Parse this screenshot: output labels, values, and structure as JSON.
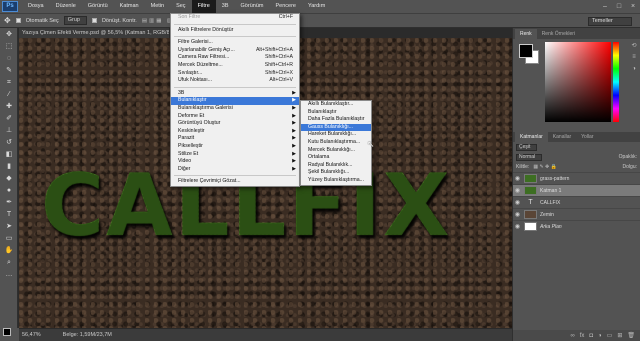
{
  "app": {
    "logo": "Ps"
  },
  "menubar": {
    "items": [
      "Dosya",
      "Düzenle",
      "Görüntü",
      "Katman",
      "Metin",
      "Seç",
      "Filtre",
      "3B",
      "Görünüm",
      "Pencere",
      "Yardım"
    ],
    "active_index": 6
  },
  "options_bar": {
    "auto_select_label": "Otomatik Seç",
    "auto_select_value": "Grup",
    "transform_label": "Dönüşt. Kontr.",
    "workspace": "Temeller"
  },
  "document": {
    "tab_title": "Yazıya Çimen Efekti Verme.psd @ 56,5% (Katman 1, RGB/8)",
    "canvas_text": "CALLFIX",
    "zoom": "56,47%",
    "doc_info": "Belge: 1,59M/23,7M"
  },
  "filter_menu": {
    "items": [
      {
        "label": "Son Filtre",
        "shortcut": "Ctrl+F",
        "disabled": true
      },
      {
        "sep": true
      },
      {
        "label": "Akıllı Filtrelere Dönüştür"
      },
      {
        "sep": true
      },
      {
        "label": "Filtre Galerisi..."
      },
      {
        "label": "Uyarlanabilir Geniş Açı...",
        "shortcut": "Alt+Shift+Ctrl+A"
      },
      {
        "label": "Camera Raw Filtresi...",
        "shortcut": "Shift+Ctrl+A"
      },
      {
        "label": "Mercek Düzeltme...",
        "shortcut": "Shift+Ctrl+R"
      },
      {
        "label": "Sıvılaştır...",
        "shortcut": "Shift+Ctrl+X"
      },
      {
        "label": "Ufuk Noktası...",
        "shortcut": "Alt+Ctrl+V"
      },
      {
        "sep": true
      },
      {
        "label": "3B",
        "submenu": true
      },
      {
        "label": "Bulanıklaştır",
        "submenu": true,
        "highlighted": true
      },
      {
        "label": "Bulanıklaştırma Galerisi",
        "submenu": true
      },
      {
        "label": "Deforme Et",
        "submenu": true
      },
      {
        "label": "Görüntüyü Oluştur",
        "submenu": true
      },
      {
        "label": "Keskinleştir",
        "submenu": true
      },
      {
        "label": "Parazit",
        "submenu": true
      },
      {
        "label": "Pikselleştir",
        "submenu": true
      },
      {
        "label": "Stilize Et",
        "submenu": true
      },
      {
        "label": "Video",
        "submenu": true
      },
      {
        "label": "Diğer",
        "submenu": true
      },
      {
        "sep": true
      },
      {
        "label": "Filtrelere Çevrimiçi Gözat..."
      }
    ]
  },
  "blur_submenu": {
    "items": [
      {
        "label": "Akıllı Bulanıklaştır..."
      },
      {
        "label": "Bulanıklaştır"
      },
      {
        "label": "Daha Fazla Bulanıklaştır"
      },
      {
        "label": "Gauss Bulanıklığı...",
        "highlighted": true
      },
      {
        "label": "Hareket Bulanıklığı..."
      },
      {
        "label": "Kutu Bulanıklaştırma..."
      },
      {
        "label": "Mercek Bulanıklığı..."
      },
      {
        "label": "Ortalama"
      },
      {
        "label": "Radyal Bulanıklık..."
      },
      {
        "label": "Şekil Bulanıklığı..."
      },
      {
        "label": "Yüzey Bulanıklaştırma..."
      }
    ]
  },
  "color_panel": {
    "tabs": [
      "Renk",
      "Renk Örnekleri"
    ]
  },
  "layers_panel": {
    "tabs": [
      "Katmanlar",
      "Kanallar",
      "Yollar"
    ],
    "filter_label": "Çeşit",
    "blend_mode": "Normal",
    "opacity_label": "Opaklık:",
    "lock_label": "Kilitle:",
    "fill_label": "Dolgu:",
    "layers": [
      {
        "name": "grass-pattern",
        "thumb": "grass"
      },
      {
        "name": "Katman 1",
        "thumb": "grass",
        "selected": true
      },
      {
        "name": "CALLFIX",
        "thumb": "text"
      },
      {
        "name": "Zemin",
        "thumb": "soil"
      },
      {
        "name": "Arka Plan",
        "thumb": "white",
        "italic": true
      }
    ]
  }
}
